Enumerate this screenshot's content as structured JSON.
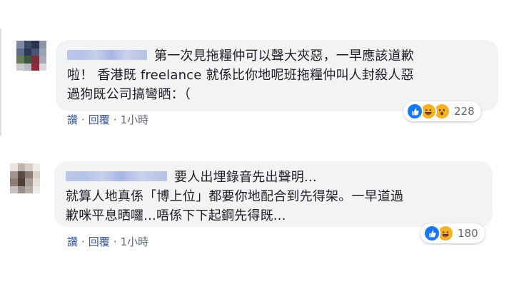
{
  "comments": [
    {
      "text": "第一次見拖糧仲可以聲大夾惡，一早應該道歉\n啦！ 香港既 freelance 就係比你地呢班拖糧仲叫人封殺人惡\n過狗既公司搞彎晒：（",
      "actions": {
        "like": "讚",
        "reply": "回覆",
        "time": "1小時"
      },
      "reactions": {
        "icons": [
          "like-icon",
          "haha-icon",
          "wow-icon"
        ],
        "count": "228"
      }
    },
    {
      "text": "要人出埋錄音先出聲明...\n就算人地真係「博上位」都要你地配合到先得架。一早道過\n歉咪平息晒囉...唔係下下起鋼先得既...",
      "actions": {
        "like": "讚",
        "reply": "回覆",
        "time": "1小時"
      },
      "reactions": {
        "icons": [
          "like-icon",
          "haha-icon"
        ],
        "count": "180"
      }
    }
  ],
  "colors": {
    "bubble": "#f2f3f5",
    "link": "#385898",
    "meta": "#606770",
    "like": "#1877f2",
    "haha": "#f7b125"
  }
}
